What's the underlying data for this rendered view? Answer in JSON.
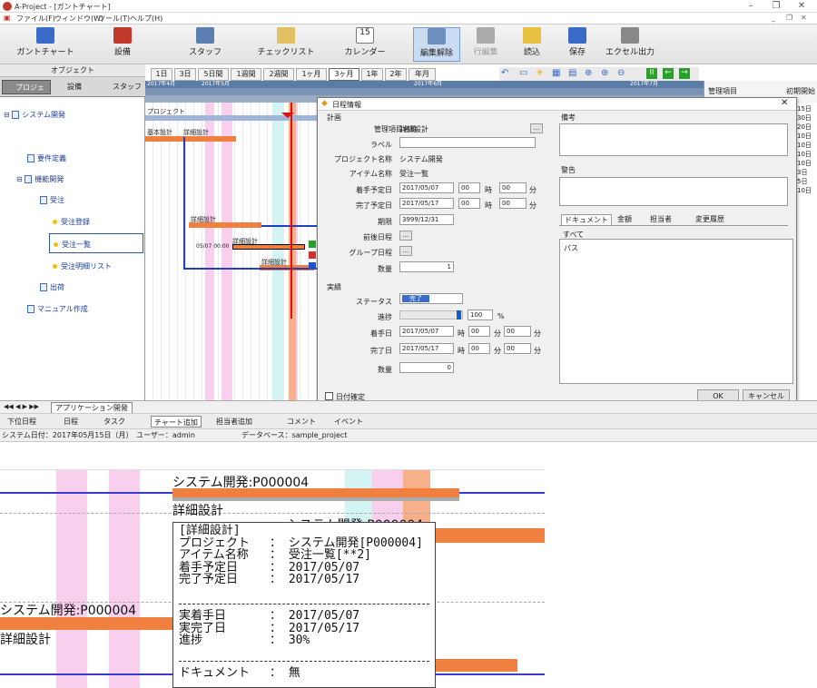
{
  "window": {
    "title": "A-Project - [ガントチャート]"
  },
  "menu": [
    "ファイル(F)",
    "ウィンドウ(W)",
    "ツール(T)",
    "ヘルプ(H)"
  ],
  "toolbar": {
    "buttons": [
      "ガントチャート",
      "設備",
      "スタッフ",
      "チェックリスト",
      "カレンダー",
      "編集解除",
      "行編集",
      "読込",
      "保存",
      "エクセル出力"
    ]
  },
  "object_panel": {
    "title": "オブジェクト",
    "tabs": [
      "プロジェクト",
      "設備",
      "スタッフ"
    ],
    "tree": [
      "システム開発",
      "要件定義",
      "機能開発",
      "受注",
      "受注登録",
      "受注一覧",
      "受注明細リスト",
      "出荷",
      "マニュアル作成"
    ]
  },
  "gantt": {
    "scales": [
      "1日",
      "3日",
      "5日間",
      "1週間",
      "2週間",
      "1ヶ月",
      "3ヶ月",
      "1年",
      "2年",
      "年月"
    ],
    "year_months": [
      "2017年4月",
      "2017年5月",
      "2017年6月",
      "2017年7月"
    ],
    "right_header": [
      "管理項目",
      "初期開始"
    ],
    "right_values": [
      "15日",
      "30日",
      "20日",
      "10日",
      "10日",
      "10日",
      "10日",
      "3日",
      "5日",
      "10日"
    ],
    "bar_labels": [
      "プロジェクト",
      "基本設計",
      "詳細設計",
      "詳細設計",
      "詳細設計",
      "詳細設計"
    ],
    "milestone_text": "05/07 00:00"
  },
  "dialog": {
    "title": "日程情報",
    "plan_section": "計画",
    "fields": {
      "mgmt_name_label": "管理項目名称",
      "mgmt_name": "詳細設計",
      "label_label": "ラベル",
      "label_value": "",
      "project_name_label": "プロジェクト名称",
      "project_name": "システム開発",
      "item_name_label": "アイテム名称",
      "item_name": "受注一覧",
      "plan_start_label": "着手予定日",
      "plan_start": "2017/05/07",
      "plan_end_label": "完了予定日",
      "plan_end": "2017/05/17",
      "deadline_label": "期限",
      "deadline": "3999/12/31",
      "prev_next_label": "前後日程",
      "group_label": "グループ日程",
      "qty_label": "数量",
      "qty": "1",
      "hour_zero": "00",
      "hour_unit": "時",
      "min_unit": "分"
    },
    "actual_section": "実績",
    "actual": {
      "status_label": "ステータス",
      "status": "完了",
      "progress_label": "進捗",
      "progress": "100",
      "pct": "%",
      "start_label": "着手日",
      "start": "2017/05/07",
      "end_label": "完了日",
      "end": "2017/05/17",
      "qty_label": "数量",
      "qty": "0"
    },
    "notes_label": "備考",
    "warning_label": "警告",
    "tabs": [
      "ドキュメント",
      "金額",
      "担当者",
      "変更履歴"
    ],
    "filter": "すべて",
    "doc_item": "パス",
    "date_fixed": "日付確定",
    "ok": "OK",
    "cancel": "キャンセル"
  },
  "bottom_tabs": {
    "sheet": "アプリケーション開発"
  },
  "bottom_toolbar": [
    "下位日程",
    "日程",
    "タスク",
    "チャート追加",
    "担当者追加",
    "コメント",
    "イベント"
  ],
  "status": {
    "date": "システム日付：2017年05月15日（月）",
    "user": "ユーザー：admin",
    "db": "データベース：sample_project"
  },
  "zoom": {
    "labels": [
      "システム開発:P000004",
      "詳細設計",
      "システム開発:P000004",
      "システム開発:P000004",
      "詳細設計"
    ],
    "tooltip": {
      "head": "[詳細設計]",
      "rows": [
        [
          "プロジェクト",
          "：",
          "システム開発[P000004]"
        ],
        [
          "アイテム名称",
          "：",
          "受注一覧[**2]"
        ],
        [
          "着手予定日",
          "：",
          "2017/05/07"
        ],
        [
          "完了予定日",
          "：",
          "2017/05/17"
        ]
      ],
      "rows2": [
        [
          "実着手日",
          "：",
          "2017/05/07"
        ],
        [
          "実完了日",
          "：",
          "2017/05/17"
        ],
        [
          "進捗",
          "：",
          "30%"
        ]
      ],
      "doc": [
        "ドキュメント",
        "：",
        "無"
      ]
    }
  }
}
